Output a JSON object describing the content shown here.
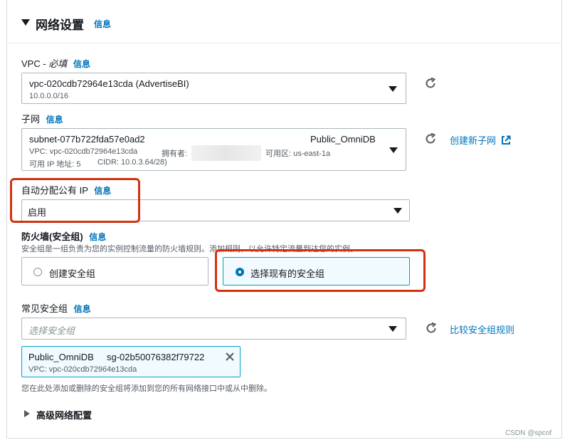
{
  "section": {
    "title": "网络设置",
    "info": "信息"
  },
  "vpc": {
    "label": "VPC - ",
    "required": "必填",
    "info": "信息",
    "value": "vpc-020cdb72964e13cda (AdvertiseBI)",
    "cidr": "10.0.0.0/16"
  },
  "subnet": {
    "label": "子网",
    "info": "信息",
    "id": "subnet-077b722fda57e0ad2",
    "name": "Public_OmniDB",
    "vpc_line": "VPC: vpc-020cdb72964e13cda",
    "owner_label": "拥有者:",
    "az": "可用区: us-east-1a",
    "ip_line": "可用 IP 地址: 5",
    "cidr_line": "CIDR: 10.0.3.64/28)",
    "create_link": "创建新子网"
  },
  "auto_ip": {
    "label": "自动分配公有 IP",
    "info": "信息",
    "value": "启用"
  },
  "firewall": {
    "label": "防火墙(安全组)",
    "info": "信息",
    "desc": "安全组是一组负责为您的实例控制流量的防火墙规则。添加规则，以允许特定流量到达您的实例。",
    "option_create": "创建安全组",
    "option_select": "选择现有的安全组"
  },
  "common_sg": {
    "label": "常见安全组",
    "info": "信息",
    "placeholder": "选择安全组",
    "compare_link": "比较安全组规则",
    "tag": {
      "name": "Public_OmniDB",
      "id": "sg-02b50076382f79722",
      "vpc": "VPC: vpc-020cdb72964e13cda"
    },
    "note": "您在此处添加或删除的安全组将添加到您的所有网络接口中或从中删除。"
  },
  "advanced": {
    "label": "高级网络配置"
  },
  "watermark": "CSDN @spcof"
}
